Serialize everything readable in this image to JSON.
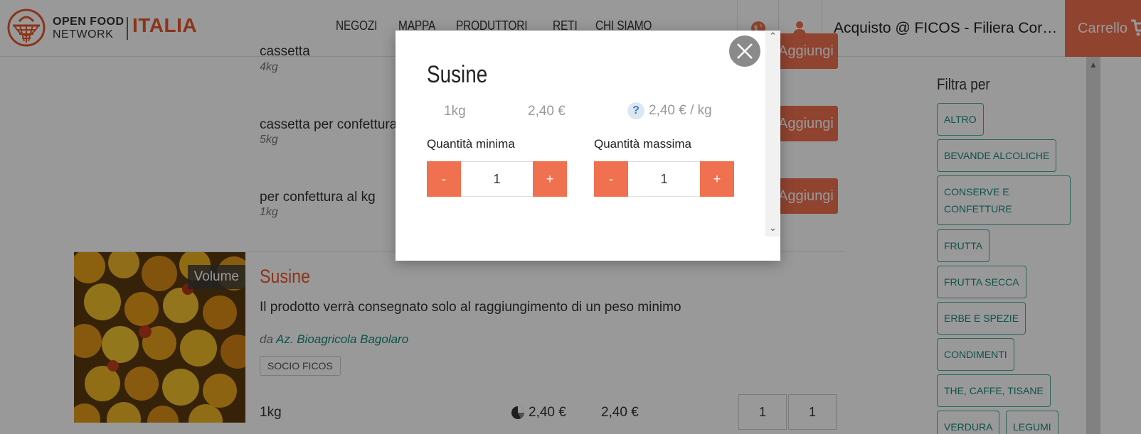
{
  "header": {
    "logo_line1": "OPEN FOOD",
    "logo_line2": "NETWORK",
    "logo_country": "ITALIA",
    "nav": [
      "NEGOZI",
      "MAPPA",
      "PRODUTTORI",
      "RETI",
      "CHI SIAMO"
    ],
    "shop_name": "Acquisto @ FICOS - Filiera Cort…",
    "cart_label": "Carrello"
  },
  "variants": [
    {
      "name": "cassetta",
      "size": "4kg",
      "button": "Aggiungi"
    },
    {
      "name": "cassetta per confettura",
      "size": "5kg",
      "button": "Aggiungi"
    },
    {
      "name": "per confettura al kg",
      "size": "1kg",
      "button": "Aggiungi"
    }
  ],
  "product": {
    "badge": "Volume",
    "title": "Susine",
    "description": "Il prodotto verrà consegnato solo al raggiungimento di un peso minimo",
    "producer_prefix": "da",
    "producer": "Az. Bioagricola Bagolaro",
    "tag": "SOCIO FICOS",
    "unit": "1kg",
    "price": "2,40 €",
    "price2": "2,40 €",
    "qty_min": "1",
    "qty_max": "1"
  },
  "sidebar": {
    "title": "Filtra per",
    "chips": [
      "ALTRO",
      "BEVANDE ALCOLICHE",
      "CONSERVE E CONFETTURE",
      "FRUTTA",
      "FRUTTA SECCA",
      "ERBE E SPEZIE",
      "CONDIMENTI",
      "THE, CAFFE, TISANE",
      "VERDURA",
      "LEGUMI"
    ]
  },
  "modal": {
    "title": "Susine",
    "unit": "1kg",
    "price": "2,40 €",
    "unit_price": "2,40 € / kg",
    "help_glyph": "?",
    "min_label": "Quantità minima",
    "max_label": "Quantità massima",
    "min_value": "1",
    "max_value": "1",
    "minus": "-",
    "plus": "+"
  },
  "colors": {
    "accent": "#f0714f",
    "brand": "#e8582c",
    "teal": "#1a8a7c"
  }
}
